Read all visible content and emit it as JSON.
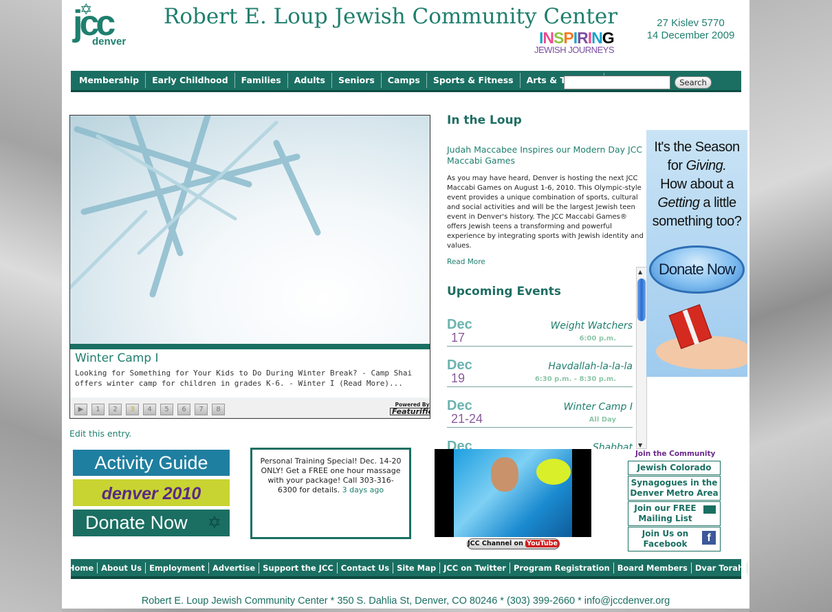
{
  "header": {
    "logo_text": "jcc",
    "logo_sub": "denver",
    "title": "Robert E. Loup Jewish Community Center",
    "tagline_letters": [
      "I",
      "N",
      "S",
      "P",
      "I",
      "R",
      "I",
      "N",
      "G"
    ],
    "tagline_word": "INSPIRING",
    "tagline_sub": "JEWISH JOURNEYS",
    "hebrew_date": "27 Kislev 5770",
    "gregorian_date": "14 December 2009"
  },
  "nav": {
    "items": [
      "Membership",
      "Early Childhood",
      "Families",
      "Adults",
      "Seniors",
      "Camps",
      "Sports & Fitness",
      "Arts & Theatre"
    ],
    "search_value": "",
    "search_label": "Search"
  },
  "slideshow": {
    "title": "Winter Camp I",
    "text": "Looking for Something for Your Kids to Do During Winter Break? - Camp Shai offers winter camp for children in grades K-6. - Winter I (Read More)...",
    "play_label": "▶",
    "pages": [
      "1",
      "2",
      "3",
      "4",
      "5",
      "6",
      "7",
      "8"
    ],
    "active_page": 3,
    "powered_by": "Powered By",
    "powered_brand": "Featurific",
    "edit_link": "Edit this entry."
  },
  "loop": {
    "title": "In the Loup",
    "headline": "Judah Maccabee Inspires our Modern Day JCC Maccabi Games",
    "body": "As you may have heard, Denver is hosting the next JCC Maccabi Games on August 1-6, 2010. This Olympic-style event provides a unique combination of sports, cultural and social activities and will be the largest Jewish teen event in Denver's history. The JCC Maccabi Games® offers Jewish teens a transforming and powerful experience by integrating sports with Jewish identity and values.",
    "read_more": "Read More"
  },
  "events": {
    "title": "Upcoming Events",
    "items": [
      {
        "month": "Dec",
        "day": "17",
        "name": "Weight Watchers",
        "time": "6:00 p.m."
      },
      {
        "month": "Dec",
        "day": "19",
        "name": "Havdallah-la-la-la",
        "time": "6:30 p.m. - 8:30 p.m."
      },
      {
        "month": "Dec",
        "day": "21-24",
        "name": "Winter Camp I",
        "time": "All Day"
      },
      {
        "month": "Dec",
        "day": "",
        "name": "Shabbat",
        "time": ""
      }
    ]
  },
  "ad": {
    "line1": "It's the Season",
    "line2a": "for ",
    "line2b": "Giving.",
    "line3": "How about a",
    "line4a": "Getting",
    "line4b": " a little",
    "line5": "something  too?",
    "button": "Donate Now"
  },
  "promos": {
    "activity_guide": "Activity Guide",
    "denver2010": "denver 2010",
    "donate_now": "Donate Now",
    "training_text": "Personal Training Special! Dec. 14-20 ONLY! Get a FREE one hour massage with your package! Call 303-316-6300 for details.",
    "training_ago": "3 days ago",
    "youtube_label": "JCC Channel on",
    "youtube_brand": "YouTube"
  },
  "community": {
    "title": "Join the Community",
    "links": [
      "Jewish Colorado",
      "Synagogues in the Denver Metro Area",
      "Join our FREE Mailing List",
      "Join Us on Facebook"
    ]
  },
  "footer": {
    "links": [
      "Home",
      "About Us",
      "Employment",
      "Advertise",
      "Support the JCC",
      "Contact Us",
      "Site Map",
      "JCC on Twitter",
      "Program Registration",
      "Board Members",
      "Dvar Torah"
    ],
    "address": "Robert E. Loup Jewish Community Center * 350 S. Dahlia St, Denver, CO 80246 * (303) 399-2660 * info@jccdenver.org"
  },
  "colors": {
    "brand_teal": "#1a6f62",
    "accent_purple": "#6a2a8a"
  }
}
